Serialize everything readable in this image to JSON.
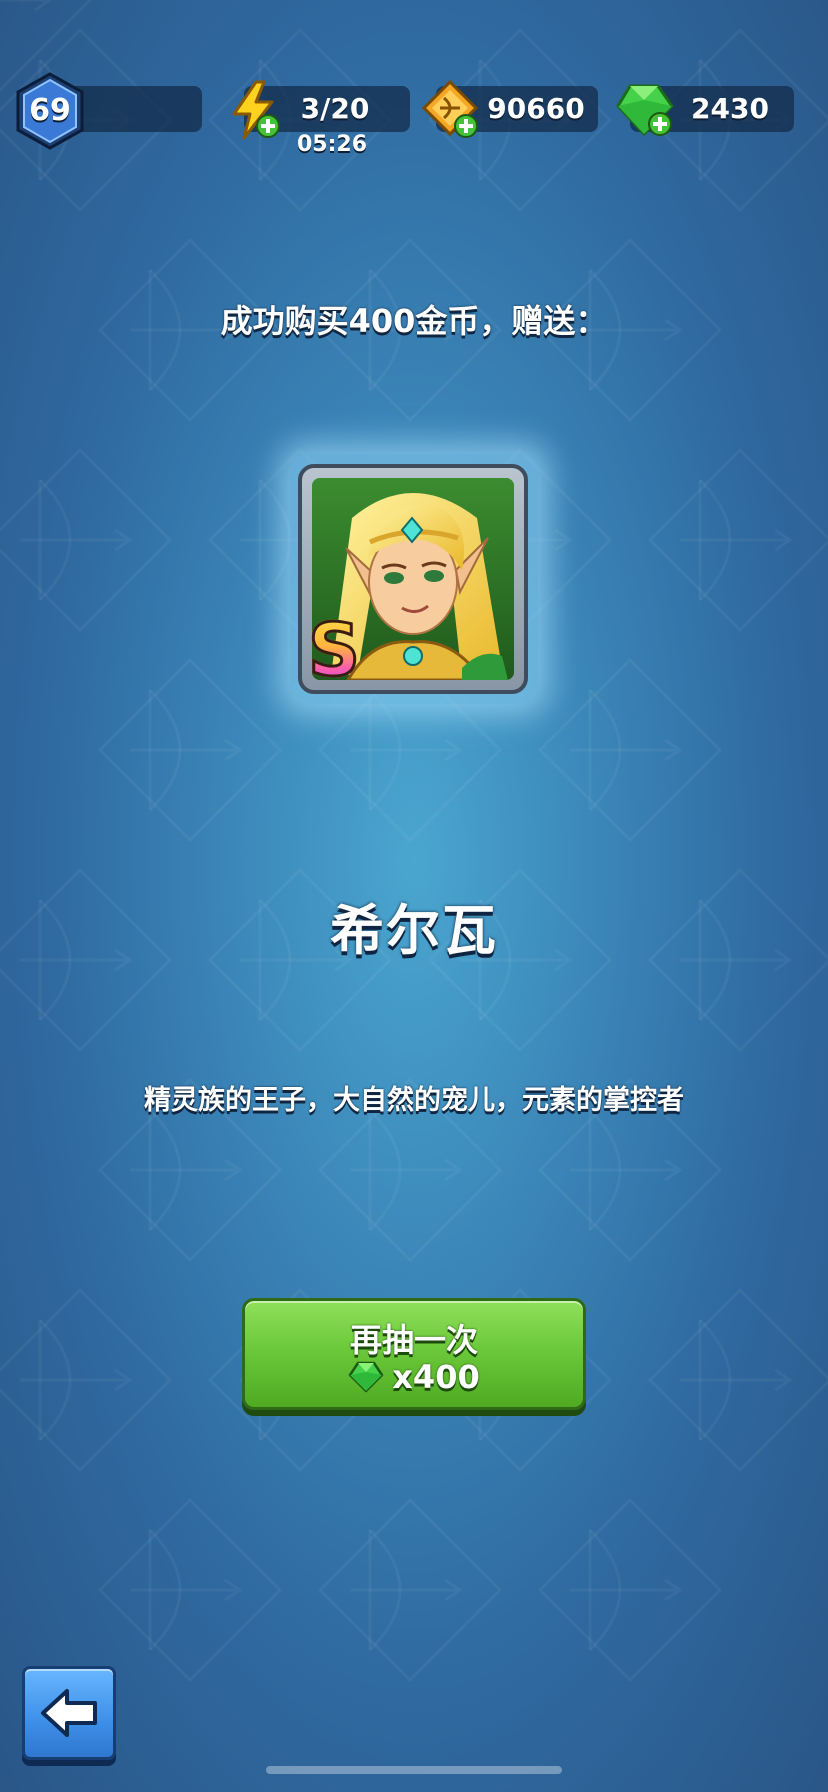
{
  "hud": {
    "level": "69",
    "energy": "3/20",
    "energy_timer": "05:26",
    "gold": "90660",
    "gems": "2430"
  },
  "reward": {
    "message": "成功购买400金币，赠送：",
    "hero_rank": "S",
    "hero_name": "希尔瓦",
    "hero_description": "精灵族的王子，大自然的宠儿，元素的掌控者"
  },
  "draw_again": {
    "label": "再抽一次",
    "cost": "x400"
  },
  "icons": {
    "level": "hexagon-level-badge",
    "energy": "lightning-plus-icon",
    "gold": "gold-coin-bow-plus-icon",
    "gem": "green-gem-plus-icon",
    "back": "back-arrow-icon"
  },
  "colors": {
    "background": "#3b86b8",
    "button_green": "#6cc93a",
    "back_button_blue": "#3d8fe8",
    "gem_green": "#46d14a",
    "energy_yellow": "#ffd21f",
    "gold_orange": "#f5a623"
  }
}
